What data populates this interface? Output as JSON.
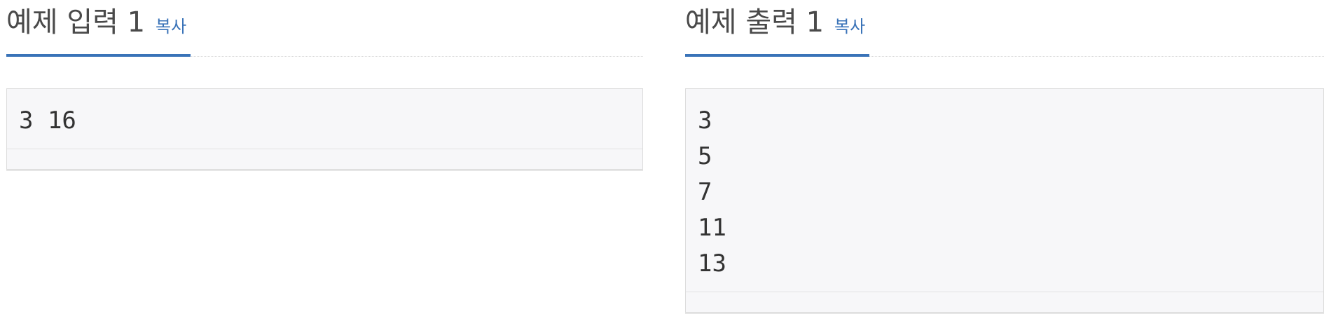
{
  "input_panel": {
    "title": "예제 입력 1",
    "copy_label": "복사",
    "content": "3 16"
  },
  "output_panel": {
    "title": "예제 출력 1",
    "copy_label": "복사",
    "content": "3\n5\n7\n11\n13"
  },
  "colors": {
    "accent": "#3a73b8",
    "title_text": "#4a4a4a",
    "sample_background": "#f7f7f9",
    "sample_border": "#dcdcdc",
    "sample_text": "#333333"
  }
}
